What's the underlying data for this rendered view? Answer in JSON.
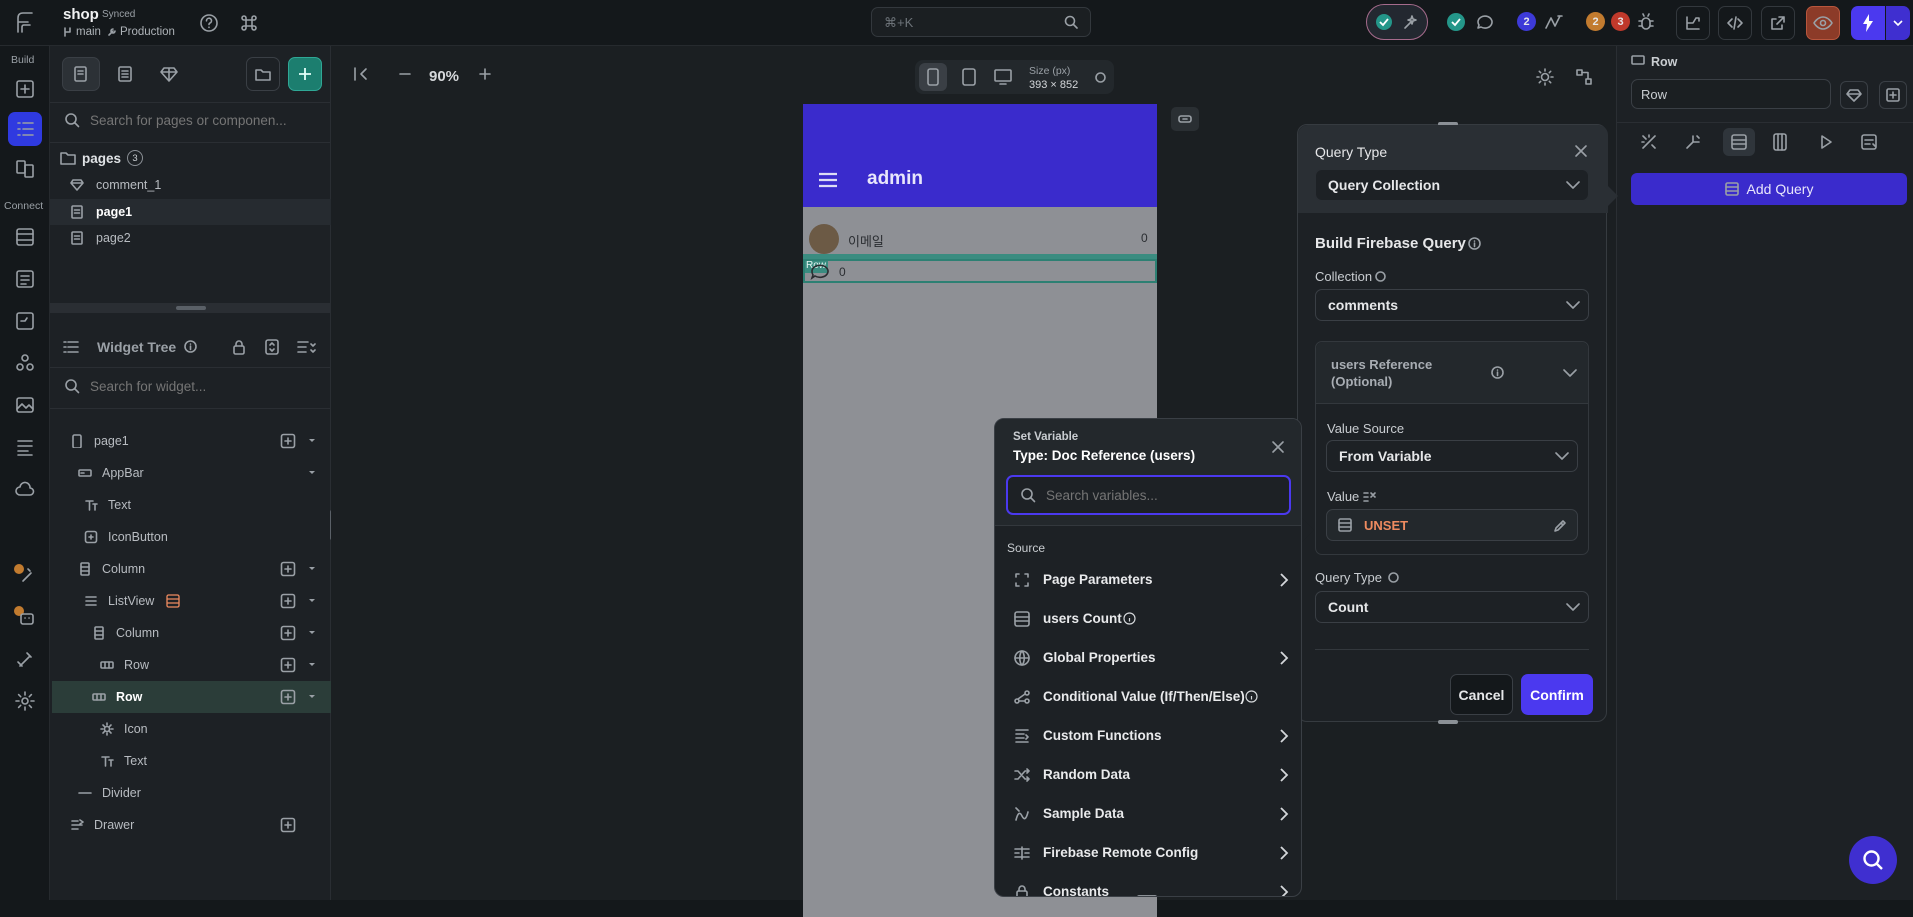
{
  "topbar": {
    "project_name": "shop",
    "sync_status": "Synced",
    "branch": "main",
    "environment": "Production",
    "command_search": "⌘+K",
    "badges": {
      "status_ok_1": "",
      "count_blue": "2",
      "count_orange": "2",
      "count_red": "3"
    }
  },
  "rail": {
    "build_label": "Build",
    "connect_label": "Connect"
  },
  "left": {
    "search_pages_placeholder": "Search for pages or componen...",
    "pages_label": "pages",
    "pages_count": "3",
    "pages": [
      "comment_1",
      "page1",
      "page2"
    ],
    "widget_tree_title": "Widget Tree",
    "search_widget_placeholder": "Search for widget...",
    "tree": [
      {
        "label": "page1",
        "icon": "phone-icon"
      },
      {
        "label": "AppBar",
        "icon": "appbar-icon"
      },
      {
        "label": "Text",
        "icon": "text-icon"
      },
      {
        "label": "IconButton",
        "icon": "icon-button-icon"
      },
      {
        "label": "Column",
        "icon": "column-icon"
      },
      {
        "label": "ListView",
        "icon": "listview-icon"
      },
      {
        "label": "Column",
        "icon": "column-icon"
      },
      {
        "label": "Row",
        "icon": "row-icon"
      },
      {
        "label": "Row",
        "icon": "row-icon"
      },
      {
        "label": "Icon",
        "icon": "gear-icon"
      },
      {
        "label": "Text",
        "icon": "text-icon"
      },
      {
        "label": "Divider",
        "icon": "divider-icon"
      },
      {
        "label": "Drawer",
        "icon": "drawer-icon"
      }
    ]
  },
  "canvas": {
    "zoom": "90%",
    "size_label": "Size (px)",
    "size_value": "393 × 852",
    "appbar_title": "admin",
    "row1_text": "이메일",
    "row1_count": "0",
    "row_tag": "Row",
    "row2_count": "0"
  },
  "set_variable": {
    "title": "Set Variable",
    "type": "Type: Doc Reference (users)",
    "search_placeholder": "Search variables...",
    "source_label": "Source",
    "items": [
      {
        "label": "Page Parameters",
        "icon": "page-params-icon",
        "chevron": true,
        "info": false
      },
      {
        "label": "users Count",
        "icon": "database-icon",
        "chevron": false,
        "info": true
      },
      {
        "label": "Global Properties",
        "icon": "globe-icon",
        "chevron": true,
        "info": false
      },
      {
        "label": "Conditional Value (If/Then/Else)",
        "icon": "conditional-icon",
        "chevron": false,
        "info": true
      },
      {
        "label": "Custom Functions",
        "icon": "custom-functions-icon",
        "chevron": true,
        "info": false
      },
      {
        "label": "Random Data",
        "icon": "shuffle-icon",
        "chevron": true,
        "info": false
      },
      {
        "label": "Sample Data",
        "icon": "sample-data-icon",
        "chevron": true,
        "info": false
      },
      {
        "label": "Firebase Remote Config",
        "icon": "remote-config-icon",
        "chevron": true,
        "info": false
      },
      {
        "label": "Constants",
        "icon": "lock-icon",
        "chevron": true,
        "info": false
      }
    ]
  },
  "query": {
    "query_type_label": "Query Type",
    "query_type_value": "Query Collection",
    "build_title": "Build Firebase Query",
    "collection_label": "Collection",
    "collection_value": "comments",
    "reference_label": "users Reference (Optional)",
    "value_source_label": "Value Source",
    "value_source_value": "From Variable",
    "value_label": "Value",
    "value_value": "UNSET",
    "query_type2_label": "Query Type",
    "query_type2_value": "Count",
    "cancel": "Cancel",
    "confirm": "Confirm"
  },
  "right": {
    "widget_type": "Row",
    "widget_name": "Row",
    "add_query": "Add Query"
  },
  "colors": {
    "accent_green": "#249689",
    "accent_purple": "#4b39ef",
    "appbar": "#3a2bcc",
    "unset": "#ee8b60"
  }
}
